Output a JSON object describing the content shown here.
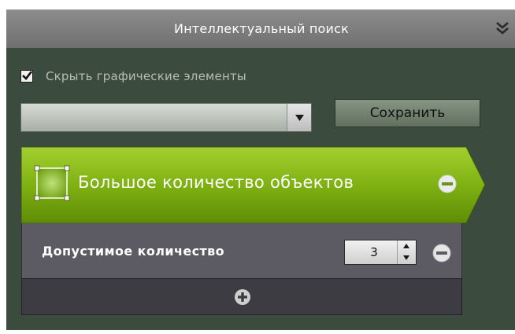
{
  "panel": {
    "title": "Интеллектуальный поиск",
    "collapse_icon": "double-chevron-down-icon"
  },
  "options": {
    "hide_graphics_label": "Скрыть графические элементы",
    "hide_graphics_checked": true
  },
  "preset": {
    "selected_value": "",
    "save_label": "Сохранить"
  },
  "rule": {
    "label": "Большое количество объектов",
    "icon": "area-selection-icon",
    "remove_icon": "minus-circle-icon",
    "accent_color": "#7fb112",
    "param": {
      "label": "Допустимое количество",
      "value": "3"
    },
    "add_icon": "plus-circle-icon"
  },
  "colors": {
    "panel_bg": "#3b4b3d",
    "header_bg": "#7f7f7f",
    "param_bg": "#5c5a63",
    "add_bg": "#3c3c42"
  }
}
